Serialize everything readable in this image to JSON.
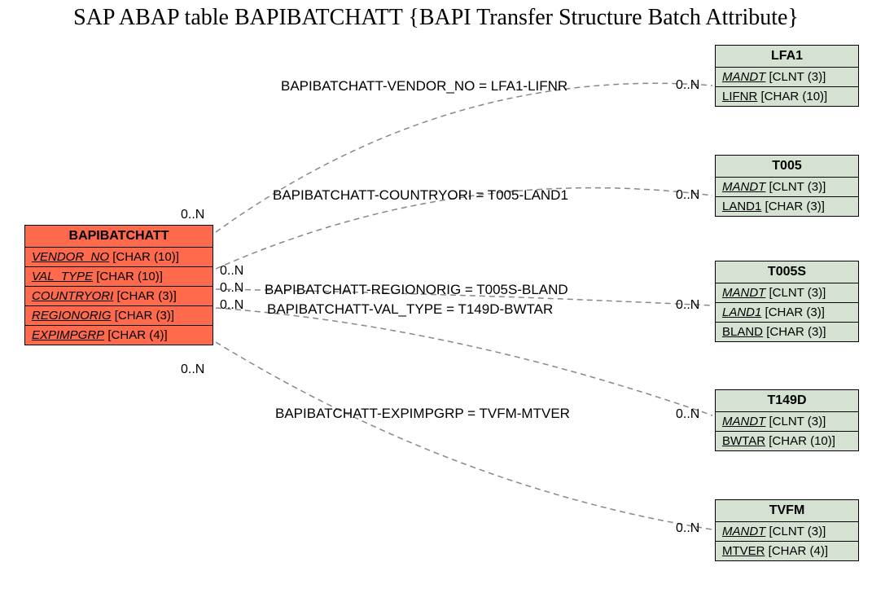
{
  "title": "SAP ABAP table BAPIBATCHATT {BAPI Transfer Structure Batch Attribute}",
  "main_entity": {
    "name": "BAPIBATCHATT",
    "fields": [
      {
        "name": "VENDOR_NO",
        "type": "[CHAR (10)]"
      },
      {
        "name": "VAL_TYPE",
        "type": "[CHAR (10)]"
      },
      {
        "name": "COUNTRYORI",
        "type": "[CHAR (3)]"
      },
      {
        "name": "REGIONORIG",
        "type": "[CHAR (3)]"
      },
      {
        "name": "EXPIMPGRP",
        "type": "[CHAR (4)]"
      }
    ]
  },
  "targets": [
    {
      "name": "LFA1",
      "fields": [
        {
          "name": "MANDT",
          "type": "[CLNT (3)]",
          "italic": true
        },
        {
          "name": "LIFNR",
          "type": "[CHAR (10)]",
          "italic": false
        }
      ]
    },
    {
      "name": "T005",
      "fields": [
        {
          "name": "MANDT",
          "type": "[CLNT (3)]",
          "italic": true
        },
        {
          "name": "LAND1",
          "type": "[CHAR (3)]",
          "italic": false
        }
      ]
    },
    {
      "name": "T005S",
      "fields": [
        {
          "name": "MANDT",
          "type": "[CLNT (3)]",
          "italic": true
        },
        {
          "name": "LAND1",
          "type": "[CHAR (3)]",
          "italic": true
        },
        {
          "name": "BLAND",
          "type": "[CHAR (3)]",
          "italic": false
        }
      ]
    },
    {
      "name": "T149D",
      "fields": [
        {
          "name": "MANDT",
          "type": "[CLNT (3)]",
          "italic": true
        },
        {
          "name": "BWTAR",
          "type": "[CHAR (10)]",
          "italic": false
        }
      ]
    },
    {
      "name": "TVFM",
      "fields": [
        {
          "name": "MANDT",
          "type": "[CLNT (3)]",
          "italic": true
        },
        {
          "name": "MTVER",
          "type": "[CHAR (4)]",
          "italic": false
        }
      ]
    }
  ],
  "relations": [
    {
      "label": "BAPIBATCHATT-VENDOR_NO = LFA1-LIFNR"
    },
    {
      "label": "BAPIBATCHATT-COUNTRYORI = T005-LAND1"
    },
    {
      "label": "BAPIBATCHATT-REGIONORIG = T005S-BLAND"
    },
    {
      "label": "BAPIBATCHATT-VAL_TYPE = T149D-BWTAR"
    },
    {
      "label": "BAPIBATCHATT-EXPIMPGRP = TVFM-MTVER"
    }
  ],
  "card": {
    "left1": "0..N",
    "left2": "0..N",
    "left3": "0..N",
    "left4": "0..N",
    "left5": "0..N",
    "r1": "0..N",
    "r2": "0..N",
    "r3": "0..N",
    "r4": "0..N",
    "r5": "0..N"
  }
}
